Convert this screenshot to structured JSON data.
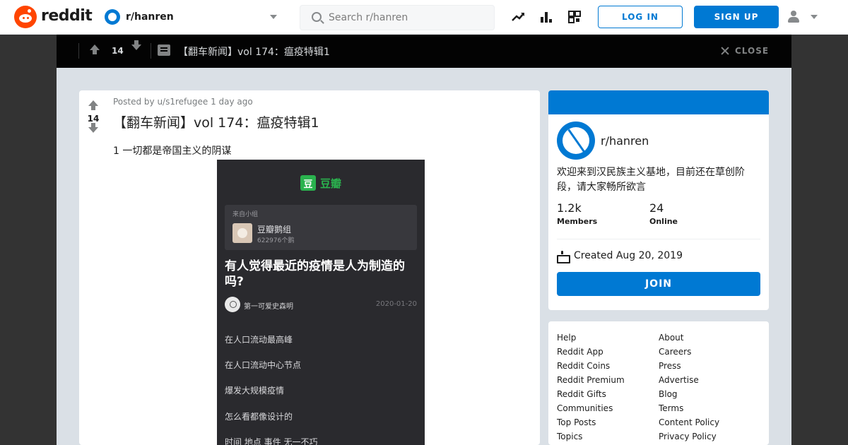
{
  "header": {
    "wordmark": "reddit",
    "subreddit": "r/hanren",
    "search_placeholder": "Search r/hanren",
    "icons": [
      "trending-icon",
      "leaderboard-icon",
      "coins-icon",
      "user-icon"
    ],
    "login_label": "LOG IN",
    "signup_label": "SIGN UP"
  },
  "overlay": {
    "score": "14",
    "title": "【翻车新闻】vol 174：瘟疫特辑1",
    "close_label": "CLOSE"
  },
  "post": {
    "score": "14",
    "posted_by": "Posted by u/s1refugee 1 day ago",
    "title": "【翻车新闻】vol 174：瘟疫特辑1",
    "body": "1 一切都是帝国主义的阴谋",
    "image": {
      "app_logo_char": "豆",
      "app_name": "豆瓣",
      "group_from": "来自小组",
      "group_name": "豆瓣鹅组",
      "group_count": "622976个鹅",
      "headline": "有人觉得最近的疫情是人为制造的吗?",
      "author": "第一可爱史森明",
      "date": "2020-01-20",
      "lines": [
        "在人口流动最高峰",
        "在人口流动中心节点",
        "爆发大规模疫情",
        "怎么看都像设计的",
        "时间 地点 事件 无一不巧"
      ]
    }
  },
  "about": {
    "name": "r/hanren",
    "description": "欢迎来到汉民族主义基地，目前还在草创阶段，请大家畅所欲言",
    "members_value": "1.2k",
    "members_label": "Members",
    "online_value": "24",
    "online_label": "Online",
    "created": "Created Aug 20, 2019",
    "join_label": "JOIN"
  },
  "footer_links": {
    "col1": [
      "Help",
      "Reddit App",
      "Reddit Coins",
      "Reddit Premium",
      "Reddit Gifts",
      "Communities",
      "Top Posts",
      "Topics"
    ],
    "col2": [
      "About",
      "Careers",
      "Press",
      "Advertise",
      "Blog",
      "Terms",
      "Content Policy",
      "Privacy Policy"
    ]
  },
  "colors": {
    "brand": "#ff4500",
    "accent": "#0079d3",
    "douban": "#2ab24e"
  }
}
